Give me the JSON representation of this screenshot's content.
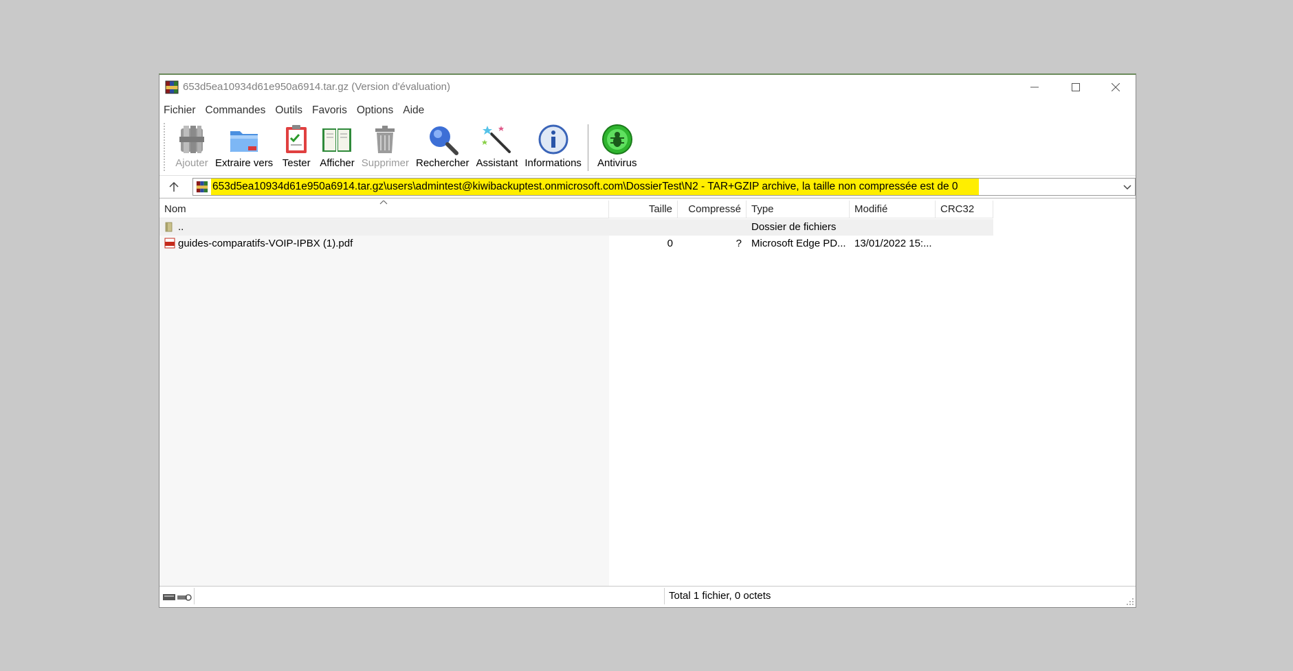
{
  "window": {
    "title": "653d5ea10934d61e950a6914.tar.gz (Version d'évaluation)"
  },
  "menu": [
    "Fichier",
    "Commandes",
    "Outils",
    "Favoris",
    "Options",
    "Aide"
  ],
  "toolbar": {
    "add": "Ajouter",
    "extract": "Extraire vers",
    "test": "Tester",
    "view": "Afficher",
    "delete": "Supprimer",
    "find": "Rechercher",
    "wizard": "Assistant",
    "info": "Informations",
    "antivirus": "Antivirus"
  },
  "address": {
    "path": "653d5ea10934d61e950a6914.tar.gz\\users\\admintest@kiwibackuptest.onmicrosoft.com\\DossierTest\\N2 - TAR+GZIP archive, la taille non compressée est de 0",
    "highlight_color": "#ffee00"
  },
  "columns": {
    "name": "Nom",
    "size": "Taille",
    "packed": "Compressé",
    "type": "Type",
    "modified": "Modifié",
    "crc": "CRC32"
  },
  "rows": [
    {
      "name": "..",
      "size": "",
      "packed": "",
      "type": "Dossier de fichiers",
      "modified": "",
      "crc": "",
      "icon": "folder-icon"
    },
    {
      "name": "guides-comparatifs-VOIP-IPBX (1).pdf",
      "size": "0",
      "packed": "?",
      "type": "Microsoft Edge PD...",
      "modified": "13/01/2022 15:...",
      "crc": "",
      "icon": "pdf-icon"
    }
  ],
  "status": {
    "total": "Total 1 fichier, 0 octets"
  }
}
